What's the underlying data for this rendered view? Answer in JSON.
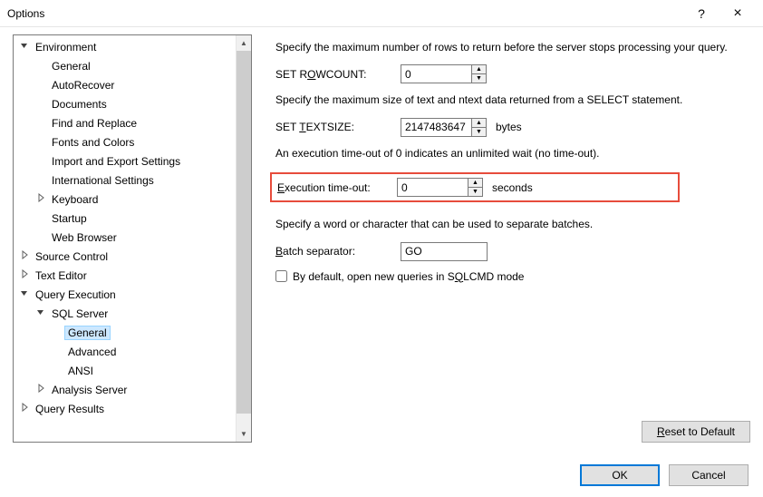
{
  "window": {
    "title": "Options",
    "help": "?",
    "close": "×"
  },
  "tree": [
    {
      "label": "Environment",
      "depth": 0,
      "exp": "open"
    },
    {
      "label": "General",
      "depth": 1
    },
    {
      "label": "AutoRecover",
      "depth": 1
    },
    {
      "label": "Documents",
      "depth": 1
    },
    {
      "label": "Find and Replace",
      "depth": 1
    },
    {
      "label": "Fonts and Colors",
      "depth": 1
    },
    {
      "label": "Import and Export Settings",
      "depth": 1
    },
    {
      "label": "International Settings",
      "depth": 1
    },
    {
      "label": "Keyboard",
      "depth": 1,
      "exp": "closed"
    },
    {
      "label": "Startup",
      "depth": 1
    },
    {
      "label": "Web Browser",
      "depth": 1
    },
    {
      "label": "Source Control",
      "depth": 0,
      "exp": "closed"
    },
    {
      "label": "Text Editor",
      "depth": 0,
      "exp": "closed"
    },
    {
      "label": "Query Execution",
      "depth": 0,
      "exp": "open"
    },
    {
      "label": "SQL Server",
      "depth": 1,
      "exp": "open"
    },
    {
      "label": "General",
      "depth": 2,
      "selected": true
    },
    {
      "label": "Advanced",
      "depth": 2
    },
    {
      "label": "ANSI",
      "depth": 2
    },
    {
      "label": "Analysis Server",
      "depth": 1,
      "exp": "closed"
    },
    {
      "label": "Query Results",
      "depth": 0,
      "exp": "closed"
    }
  ],
  "content": {
    "desc1": "Specify the maximum number of rows to return before the server stops processing your query.",
    "rowcount_label_pre": "SET R",
    "rowcount_label_u": "O",
    "rowcount_label_post": "WCOUNT:",
    "rowcount_value": "0",
    "desc2": "Specify the maximum size of text and ntext data returned from a SELECT statement.",
    "textsize_label_pre": "SET ",
    "textsize_label_u": "T",
    "textsize_label_post": "EXTSIZE:",
    "textsize_value": "2147483647",
    "textsize_suffix": "bytes",
    "desc3": "An execution time-out of 0 indicates an unlimited wait (no time-out).",
    "timeout_label_pre": "",
    "timeout_label_u": "E",
    "timeout_label_post": "xecution time-out:",
    "timeout_value": "0",
    "timeout_suffix": "seconds",
    "desc4": "Specify a word or character that can be used to separate batches.",
    "batch_label_pre": "",
    "batch_label_u": "B",
    "batch_label_post": "atch separator:",
    "batch_value": "GO",
    "sqlcmd_pre": "By default, open new queries in S",
    "sqlcmd_u": "Q",
    "sqlcmd_post": "LCMD mode",
    "reset_pre": "",
    "reset_u": "R",
    "reset_post": "eset to Default"
  },
  "buttons": {
    "ok": "OK",
    "cancel": "Cancel"
  }
}
